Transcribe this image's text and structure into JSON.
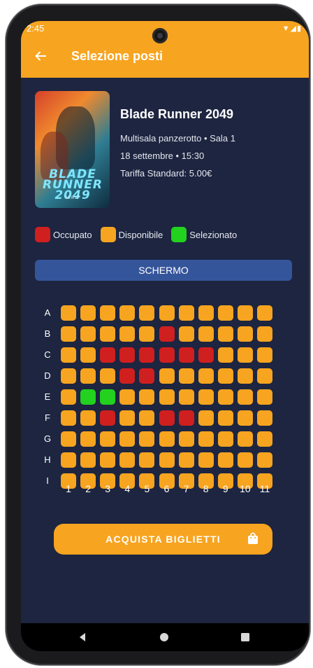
{
  "status": {
    "time": "2:45",
    "icons": "▼◢▮"
  },
  "appbar": {
    "title": "Selezione posti"
  },
  "movie": {
    "title": "Blade Runner 2049",
    "venue": "Multisala panzerotto • Sala 1",
    "datetime": "18 settembre • 15:30",
    "tariff": "Tariffa Standard: 5.00€",
    "poster_title": "BLADE RUNNER 2049",
    "poster_date": "10.6.17"
  },
  "legend": [
    {
      "label": "Occupato",
      "color": "#cf1f1f"
    },
    {
      "label": "Disponibile",
      "color": "#f7a420"
    },
    {
      "label": "Selezionato",
      "color": "#22d21e"
    }
  ],
  "screen_label": "SCHERMO",
  "seating": {
    "rows": [
      "A",
      "B",
      "C",
      "D",
      "E",
      "F",
      "G",
      "H",
      "I"
    ],
    "columns": [
      "1",
      "2",
      "3",
      "4",
      "5",
      "6",
      "7",
      "8",
      "9",
      "10",
      "11"
    ],
    "colors": {
      "available": "#f7a420",
      "occupied": "#cf1f1f",
      "selected": "#22d21e"
    },
    "occupied": [
      "B6",
      "C3",
      "C4",
      "C5",
      "C6",
      "C7",
      "C8",
      "D4",
      "D5",
      "F3",
      "F6",
      "F7"
    ],
    "selected": [
      "E2",
      "E3"
    ]
  },
  "buy_button": {
    "label": "ACQUISTA BIGLIETTI",
    "icon": "shopping-bag-icon"
  },
  "navigation": {
    "back": "back-triangle-icon",
    "home": "home-circle-icon",
    "recents": "recents-square-icon"
  },
  "accent_color": "#f7a420",
  "background_color": "#1d2540"
}
